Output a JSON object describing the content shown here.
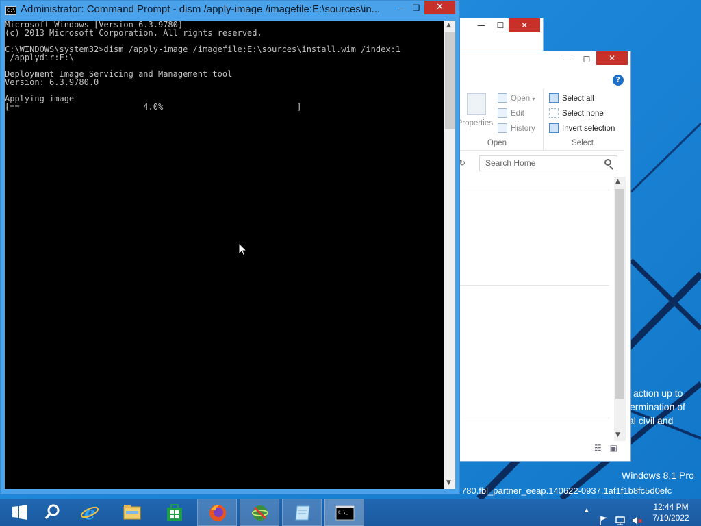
{
  "desktop": {
    "watermark_lines": [
      "action up to",
      "ermination of",
      "al civil and"
    ],
    "os_edition": "Windows 8.1 Pro",
    "build_string": "780.fbl_partner_eeap.140622-0937.1af1f1b8fc5d0efc"
  },
  "cmd_window": {
    "title": "Administrator: Command Prompt - dism  /apply-image /imagefile:E:\\sources\\in...",
    "icon": "cmd-icon",
    "controls": {
      "minimize": "—",
      "maximize": "❐",
      "close": "✕"
    },
    "console_lines": [
      "Microsoft Windows [Version 6.3.9780]",
      "(c) 2013 Microsoft Corporation. All rights reserved.",
      "",
      "C:\\WINDOWS\\system32>dism /apply-image /imagefile:E:\\sources\\install.wim /index:1",
      " /applydir:F:\\",
      "",
      "Deployment Image Servicing and Management tool",
      "Version: 6.3.9780.0",
      "",
      "Applying image",
      "[==                         4.0%                           ]"
    ],
    "progress_percent": 4.0
  },
  "explorer": {
    "controls": {
      "minimize": "—",
      "maximize": "☐",
      "close": "✕"
    },
    "help": "?",
    "ribbon": {
      "open_group": {
        "label": "Open",
        "properties_label": "Properties",
        "open_label": "Open",
        "edit_label": "Edit",
        "history_label": "History"
      },
      "select_group": {
        "label": "Select",
        "select_all": "Select all",
        "select_none": "Select none",
        "invert_selection": "Invert selection"
      }
    },
    "search_placeholder": "Search Home"
  },
  "taskbar": {
    "items": [
      {
        "name": "start-button",
        "icon": "windows-logo-icon"
      },
      {
        "name": "search-button",
        "icon": "search-icon"
      },
      {
        "name": "internet-explorer",
        "icon": "ie-icon"
      },
      {
        "name": "file-explorer",
        "icon": "folder-icon"
      },
      {
        "name": "store",
        "icon": "store-icon"
      },
      {
        "name": "firefox",
        "icon": "firefox-icon"
      },
      {
        "name": "network-app",
        "icon": "globe-icon"
      },
      {
        "name": "notepad-app",
        "icon": "notepad-icon"
      },
      {
        "name": "command-prompt",
        "icon": "cmd-icon",
        "active": true
      }
    ],
    "clock": {
      "time": "12:44 PM",
      "date": "7/19/2022"
    }
  },
  "colors": {
    "accent": "#49a2ea",
    "close_red": "#c7312a",
    "taskbar": "#1b5aa0",
    "console_bg": "#000000",
    "console_fg": "#c0c0c0"
  }
}
